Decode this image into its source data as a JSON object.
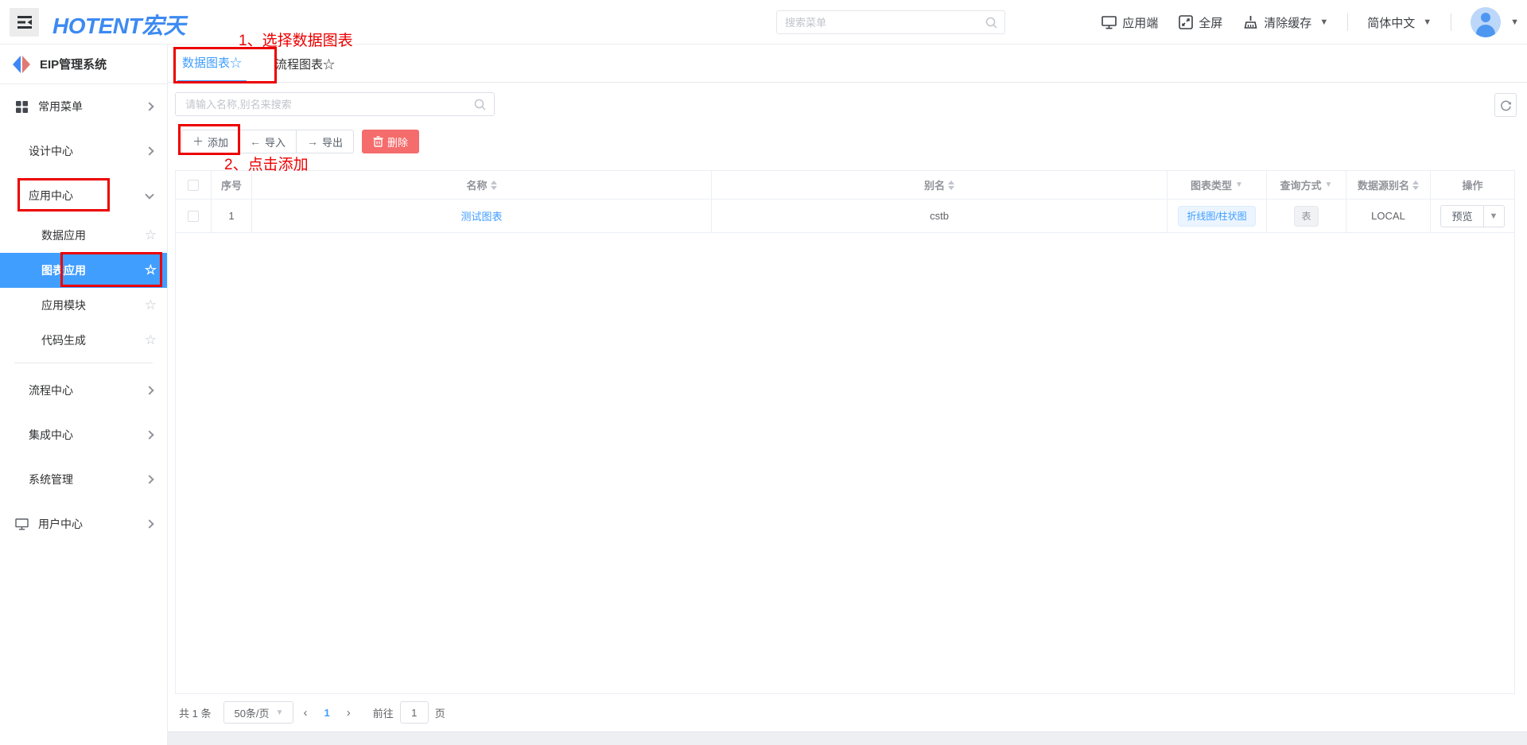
{
  "annotations": {
    "step1": "1、选择数据图表",
    "step2": "2、点击添加",
    "accent_color": "#ec0000"
  },
  "header": {
    "logo": "HOTENT宏天",
    "search_placeholder": "搜索菜单",
    "app_client": "应用端",
    "fullscreen": "全屏",
    "clear_cache": "清除缓存",
    "language": "简体中文"
  },
  "sidebar": {
    "brand": "EIP管理系统",
    "items": [
      {
        "label": "常用菜单"
      },
      {
        "label": "设计中心"
      },
      {
        "label": "应用中心"
      },
      {
        "label": "数据应用"
      },
      {
        "label": "图表应用"
      },
      {
        "label": "应用模块"
      },
      {
        "label": "代码生成"
      },
      {
        "label": "流程中心"
      },
      {
        "label": "集成中心"
      },
      {
        "label": "系统管理"
      },
      {
        "label": "用户中心"
      }
    ],
    "selected_color": "#409eff"
  },
  "tabs": {
    "tab1": "数据图表☆",
    "tab2": "流程图表☆",
    "active_color": "#409eff"
  },
  "toolbar": {
    "search_placeholder": "请输入名称,别名来搜索",
    "add": "添加",
    "import": "导入",
    "export": "导出",
    "delete": "删除",
    "danger_color": "#f56c6c"
  },
  "table": {
    "headers": {
      "seq": "序号",
      "name": "名称",
      "alias": "别名",
      "chart_type": "图表类型",
      "query_mode": "查询方式",
      "datasource": "数据源别名",
      "actions": "操作"
    },
    "rows": [
      {
        "seq": "1",
        "name": "测试图表",
        "alias": "cstb",
        "chart_type": "折线图/柱状图",
        "query_mode": "表",
        "datasource": "LOCAL",
        "action": "预览"
      }
    ]
  },
  "pagination": {
    "total": "共 1 条",
    "page_size": "50条/页",
    "current_page": "1",
    "goto_label": "前往",
    "goto_value": "1",
    "page_unit": "页"
  }
}
